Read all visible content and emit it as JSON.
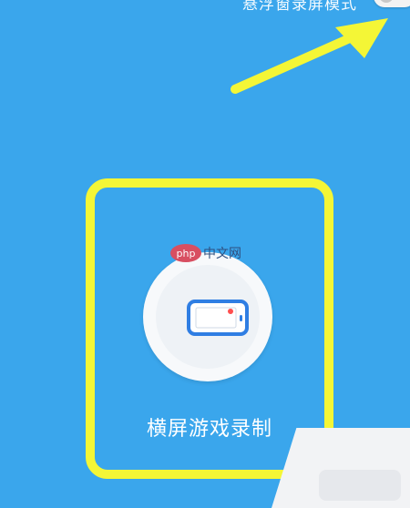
{
  "topbar": {
    "mode_label": "悬浮窗录屏模式"
  },
  "card": {
    "title": "横屏游戏录制"
  },
  "watermark": {
    "site_text": "php 中文网"
  }
}
